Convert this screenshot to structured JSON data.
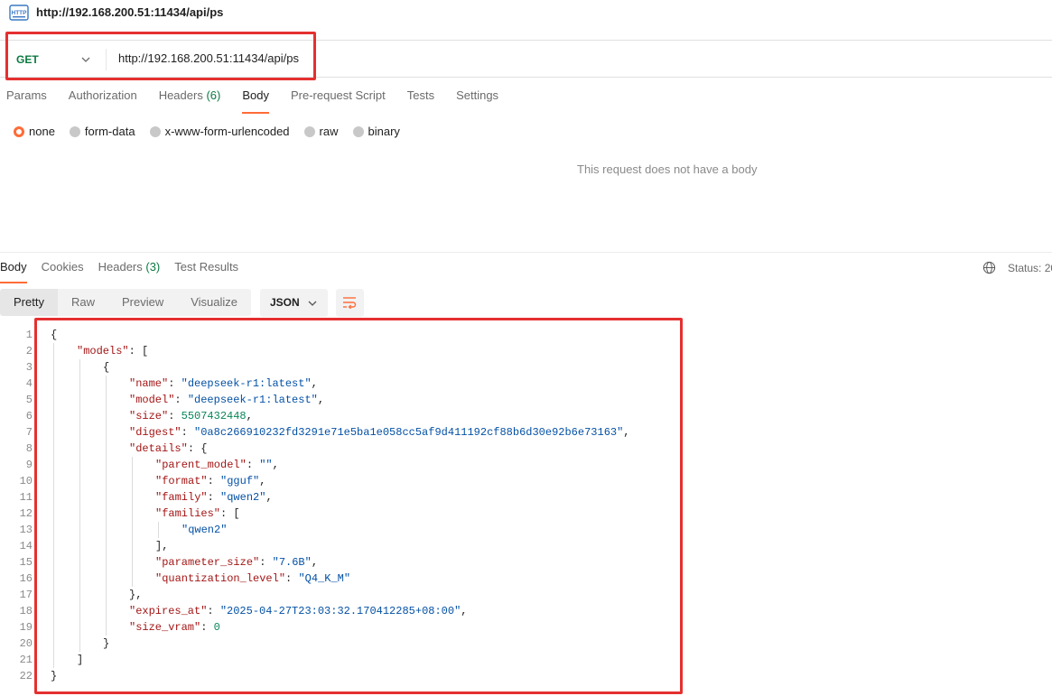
{
  "window": {
    "title": "http://192.168.200.51:11434/api/ps",
    "icon": "http-file-icon"
  },
  "request": {
    "method": "GET",
    "url": "http://192.168.200.51:11434/api/ps",
    "tabs": [
      {
        "label": "Params",
        "active": false
      },
      {
        "label": "Authorization",
        "active": false
      },
      {
        "label": "Headers",
        "count": "(6)",
        "active": false
      },
      {
        "label": "Body",
        "active": true
      },
      {
        "label": "Pre-request Script",
        "active": false
      },
      {
        "label": "Tests",
        "active": false
      },
      {
        "label": "Settings",
        "active": false
      }
    ],
    "body_options": [
      {
        "label": "none",
        "selected": true
      },
      {
        "label": "form-data",
        "selected": false
      },
      {
        "label": "x-www-form-urlencoded",
        "selected": false
      },
      {
        "label": "raw",
        "selected": false
      },
      {
        "label": "binary",
        "selected": false
      }
    ],
    "empty_body_message": "This request does not have a body"
  },
  "response": {
    "tabs": [
      {
        "label": "Body",
        "active": true
      },
      {
        "label": "Cookies",
        "active": false
      },
      {
        "label": "Headers",
        "count": "(3)",
        "active": false
      },
      {
        "label": "Test Results",
        "active": false
      }
    ],
    "status_text": "Status: 20",
    "view_modes": [
      "Pretty",
      "Raw",
      "Preview",
      "Visualize"
    ],
    "format": "JSON",
    "code_lines": [
      {
        "n": "1",
        "indent": 0,
        "t": [
          [
            "p",
            "{"
          ]
        ]
      },
      {
        "n": "2",
        "indent": 1,
        "t": [
          [
            "k",
            "\"models\""
          ],
          [
            "p",
            ": ["
          ]
        ]
      },
      {
        "n": "3",
        "indent": 2,
        "t": [
          [
            "p",
            "{"
          ]
        ]
      },
      {
        "n": "4",
        "indent": 3,
        "t": [
          [
            "k",
            "\"name\""
          ],
          [
            "p",
            ": "
          ],
          [
            "s",
            "\"deepseek-r1:latest\""
          ],
          [
            "p",
            ","
          ]
        ]
      },
      {
        "n": "5",
        "indent": 3,
        "t": [
          [
            "k",
            "\"model\""
          ],
          [
            "p",
            ": "
          ],
          [
            "s",
            "\"deepseek-r1:latest\""
          ],
          [
            "p",
            ","
          ]
        ]
      },
      {
        "n": "6",
        "indent": 3,
        "t": [
          [
            "k",
            "\"size\""
          ],
          [
            "p",
            ": "
          ],
          [
            "n",
            "5507432448"
          ],
          [
            "p",
            ","
          ]
        ]
      },
      {
        "n": "7",
        "indent": 3,
        "t": [
          [
            "k",
            "\"digest\""
          ],
          [
            "p",
            ": "
          ],
          [
            "s",
            "\"0a8c266910232fd3291e71e5ba1e058cc5af9d411192cf88b6d30e92b6e73163\""
          ],
          [
            "p",
            ","
          ]
        ]
      },
      {
        "n": "8",
        "indent": 3,
        "t": [
          [
            "k",
            "\"details\""
          ],
          [
            "p",
            ": {"
          ]
        ]
      },
      {
        "n": "9",
        "indent": 4,
        "t": [
          [
            "k",
            "\"parent_model\""
          ],
          [
            "p",
            ": "
          ],
          [
            "s",
            "\"\""
          ],
          [
            "p",
            ","
          ]
        ]
      },
      {
        "n": "10",
        "indent": 4,
        "t": [
          [
            "k",
            "\"format\""
          ],
          [
            "p",
            ": "
          ],
          [
            "s",
            "\"gguf\""
          ],
          [
            "p",
            ","
          ]
        ]
      },
      {
        "n": "11",
        "indent": 4,
        "t": [
          [
            "k",
            "\"family\""
          ],
          [
            "p",
            ": "
          ],
          [
            "s",
            "\"qwen2\""
          ],
          [
            "p",
            ","
          ]
        ]
      },
      {
        "n": "12",
        "indent": 4,
        "t": [
          [
            "k",
            "\"families\""
          ],
          [
            "p",
            ": ["
          ]
        ]
      },
      {
        "n": "13",
        "indent": 5,
        "t": [
          [
            "s",
            "\"qwen2\""
          ]
        ]
      },
      {
        "n": "14",
        "indent": 4,
        "t": [
          [
            "p",
            "],"
          ]
        ]
      },
      {
        "n": "15",
        "indent": 4,
        "t": [
          [
            "k",
            "\"parameter_size\""
          ],
          [
            "p",
            ": "
          ],
          [
            "s",
            "\"7.6B\""
          ],
          [
            "p",
            ","
          ]
        ]
      },
      {
        "n": "16",
        "indent": 4,
        "t": [
          [
            "k",
            "\"quantization_level\""
          ],
          [
            "p",
            ": "
          ],
          [
            "s",
            "\"Q4_K_M\""
          ]
        ]
      },
      {
        "n": "17",
        "indent": 3,
        "t": [
          [
            "p",
            "},"
          ]
        ]
      },
      {
        "n": "18",
        "indent": 3,
        "t": [
          [
            "k",
            "\"expires_at\""
          ],
          [
            "p",
            ": "
          ],
          [
            "s",
            "\"2025-04-27T23:03:32.170412285+08:00\""
          ],
          [
            "p",
            ","
          ]
        ]
      },
      {
        "n": "19",
        "indent": 3,
        "t": [
          [
            "k",
            "\"size_vram\""
          ],
          [
            "p",
            ": "
          ],
          [
            "n",
            "0"
          ]
        ]
      },
      {
        "n": "20",
        "indent": 2,
        "t": [
          [
            "p",
            "}"
          ]
        ]
      },
      {
        "n": "21",
        "indent": 1,
        "t": [
          [
            "p",
            "]"
          ]
        ]
      },
      {
        "n": "22",
        "indent": 0,
        "t": [
          [
            "p",
            "}"
          ]
        ]
      }
    ]
  },
  "colors": {
    "accent": "#ff6c37",
    "method_get": "#0b7a42",
    "highlight_box": "#e53030",
    "json_key": "#a31515",
    "json_string": "#0451a5",
    "json_number": "#098658"
  }
}
